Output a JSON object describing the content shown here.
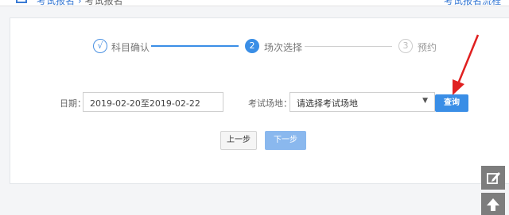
{
  "header": {
    "breadcrumb_link": "考试报名",
    "breadcrumb_sep": "›",
    "breadcrumb_current": "考试报名",
    "right_text": "考试报名流程"
  },
  "steps": [
    {
      "marker": "√",
      "label": "科目确认",
      "state": "done"
    },
    {
      "marker": "2",
      "label": "场次选择",
      "state": "active"
    },
    {
      "marker": "3",
      "label": "预约",
      "state": "todo"
    }
  ],
  "form": {
    "date_label": "日期：",
    "date_value": "2019-02-20至2019-02-22",
    "venue_label": "考试场地：",
    "venue_value": "请选择考试场地",
    "query_label": "查询"
  },
  "actions": {
    "prev_label": "上一步",
    "next_label": "下一步"
  },
  "icons": {
    "edit": "edit-icon",
    "up": "arrow-up-icon"
  },
  "colors": {
    "accent": "#3a8ee6",
    "annotation": "#e02020",
    "disabled_accent": "#8ab8ee"
  }
}
